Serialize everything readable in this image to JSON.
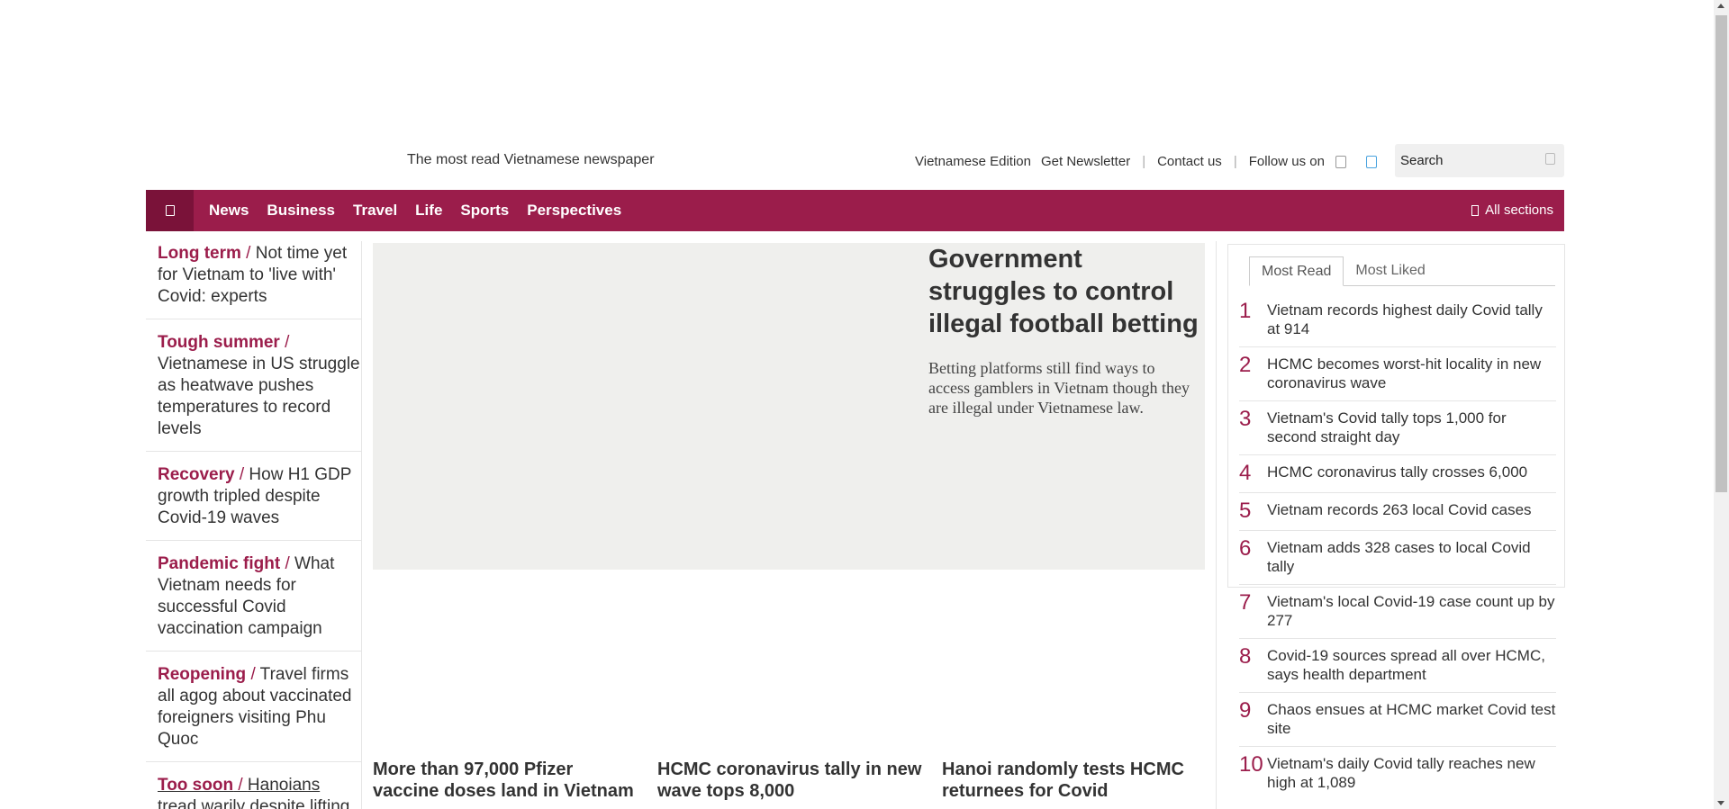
{
  "header": {
    "tagline": "The most read Vietnamese newspaper",
    "links": {
      "edition": "Vietnamese Edition",
      "newsletter": "Get Newsletter",
      "contact": "Contact us",
      "follow": "Follow us on"
    },
    "search_placeholder": "Search"
  },
  "nav": {
    "items": [
      "News",
      "Business",
      "Travel",
      "Life",
      "Sports",
      "Perspectives"
    ],
    "all_sections": "All sections",
    "color": "#9b1d4b"
  },
  "left_stories": [
    {
      "keyword": "Long term",
      "title": "Not time yet for Vietnam to 'live with' Covid: experts"
    },
    {
      "keyword": "Tough summer",
      "title": "Vietnamese in US struggle as heatwave pushes temperatures to record levels"
    },
    {
      "keyword": "Recovery",
      "title": "How H1 GDP growth tripled despite Covid-19 waves"
    },
    {
      "keyword": "Pandemic fight",
      "title": "What Vietnam needs for successful Covid vaccination campaign"
    },
    {
      "keyword": "Reopening",
      "title": "Travel firms all agog about vaccinated foreigners visiting Phu Quoc"
    },
    {
      "keyword": "Too soon",
      "title": "Hanoians tread warily despite lifting"
    }
  ],
  "hero": {
    "title": "Government struggles to control illegal football betting",
    "lead": "Betting platforms still find ways to access gamblers in Vietnam though they are illegal under Vietnamese law."
  },
  "sub_stories": [
    "More than 97,000 Pfizer vaccine doses land in Vietnam",
    "HCMC coronavirus tally in new wave tops 8,000",
    "Hanoi randomly tests HCMC returnees for Covid"
  ],
  "most_read": {
    "tabs": [
      "Most Read",
      "Most Liked"
    ],
    "items": [
      {
        "n": "1",
        "title": "Vietnam records highest daily Covid tally at 914"
      },
      {
        "n": "2",
        "title": "HCMC becomes worst-hit locality in new coronavirus wave"
      },
      {
        "n": "3",
        "title": "Vietnam's Covid tally tops 1,000 for second straight day"
      },
      {
        "n": "4",
        "title": "HCMC coronavirus tally crosses 6,000"
      },
      {
        "n": "5",
        "title": "Vietnam records 263 local Covid cases"
      },
      {
        "n": "6",
        "title": "Vietnam adds 328 cases to local Covid tally"
      },
      {
        "n": "7",
        "title": "Vietnam's local Covid-19 case count up by 277"
      },
      {
        "n": "8",
        "title": "Covid-19 sources spread all over HCMC, says health department"
      },
      {
        "n": "9",
        "title": "Chaos ensues at HCMC market Covid test site"
      },
      {
        "n": "10",
        "title": "Vietnam's daily Covid tally reaches new high at 1,089"
      }
    ]
  }
}
